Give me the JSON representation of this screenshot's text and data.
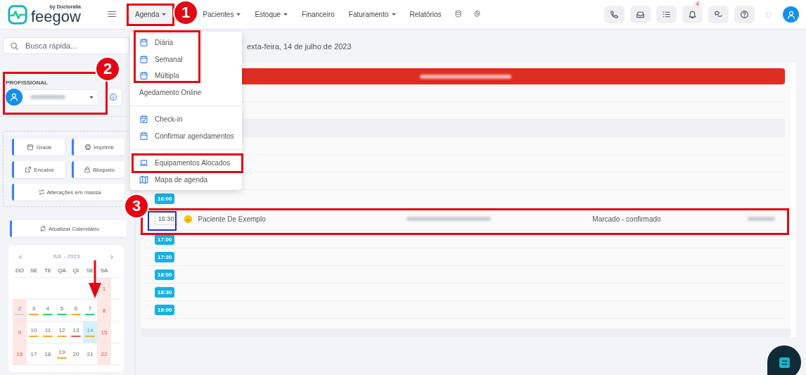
{
  "header": {
    "logo": {
      "name": "feegow",
      "tagline": "by Doctoralia"
    },
    "nav": [
      {
        "label": "Agenda",
        "caret": true,
        "selected": true
      },
      {
        "label": "Pacientes",
        "caret": true,
        "selected": false
      },
      {
        "label": "Estoque",
        "caret": true,
        "selected": false
      },
      {
        "label": "Financeiro",
        "caret": false,
        "selected": false
      },
      {
        "label": "Faturamento",
        "caret": true,
        "selected": false
      },
      {
        "label": "Relatórios",
        "caret": false,
        "selected": false
      }
    ],
    "notification_count": "4"
  },
  "agenda_menu": [
    {
      "kind": "item",
      "label": "Diária"
    },
    {
      "kind": "item",
      "label": "Semanal"
    },
    {
      "kind": "item",
      "label": "Múltipla"
    },
    {
      "kind": "plain",
      "label": "Agedamento Online"
    },
    {
      "kind": "divider"
    },
    {
      "kind": "item",
      "label": "Check-in"
    },
    {
      "kind": "item",
      "label": "Confirmar agendamentos"
    },
    {
      "kind": "divider"
    },
    {
      "kind": "item",
      "label": "Equipamentos Alocados",
      "highlighted": true
    },
    {
      "kind": "item",
      "label": "Mapa de agenda"
    }
  ],
  "sidebar": {
    "search": {
      "placeholder": "Busca rápida..."
    },
    "professional_label": "PROFISSIONAL",
    "actions": [
      {
        "label": "Grade"
      },
      {
        "label": "Imprimir"
      },
      {
        "label": "Encaixe"
      },
      {
        "label": "Bloqueio"
      },
      {
        "label": "Alterações em massa"
      }
    ],
    "refresh": "Atualizar Calendário",
    "calendar": {
      "prev": "‹",
      "month": "JUL - 2023",
      "next": "›",
      "weekdays": [
        "DO",
        "SE",
        "TE",
        "QA",
        "QI",
        "SE",
        "SA"
      ],
      "weeks": [
        [
          {
            "kind": "blank"
          },
          {
            "kind": "blank"
          },
          {
            "kind": "blank"
          },
          {
            "kind": "blank"
          },
          {
            "kind": "blank"
          },
          {
            "kind": "blank"
          },
          {
            "kind": "day",
            "day": "1",
            "selected": false
          }
        ],
        [
          {
            "kind": "day",
            "day": "2",
            "selected": false,
            "color": "#cfd3d8"
          },
          {
            "kind": "day",
            "day": "3",
            "selected": false,
            "color": "#f0ad2e"
          },
          {
            "kind": "day",
            "day": "4",
            "selected": false,
            "color": "#2ecc71"
          },
          {
            "kind": "day",
            "day": "5",
            "selected": false,
            "color": "#2ecc71"
          },
          {
            "kind": "day",
            "day": "6",
            "selected": false,
            "color": "#f0ad2e"
          },
          {
            "kind": "day",
            "day": "7",
            "selected": false,
            "color": "#2ecc71"
          },
          {
            "kind": "day",
            "day": "8",
            "selected": false
          }
        ],
        [
          {
            "kind": "day",
            "day": "9",
            "selected": false
          },
          {
            "kind": "day",
            "day": "10",
            "selected": false,
            "color": "#f0ad2e"
          },
          {
            "kind": "day",
            "day": "11",
            "selected": false,
            "color": "#f0ad2e"
          },
          {
            "kind": "day",
            "day": "12",
            "selected": false,
            "color": "#f0ad2e"
          },
          {
            "kind": "day",
            "day": "13",
            "selected": false,
            "color": "#e05a5a"
          },
          {
            "kind": "day",
            "day": "14",
            "selected": true,
            "color": "#f0ad2e"
          },
          {
            "kind": "day",
            "day": "15",
            "selected": false
          }
        ],
        [
          {
            "kind": "day",
            "day": "16",
            "selected": false
          },
          {
            "kind": "day",
            "day": "17",
            "selected": false
          },
          {
            "kind": "day",
            "day": "18",
            "selected": false
          },
          {
            "kind": "day",
            "day": "19",
            "selected": false,
            "color": "#f0ad2e"
          },
          {
            "kind": "day",
            "day": "20",
            "selected": false
          },
          {
            "kind": "day",
            "day": "21",
            "selected": false
          },
          {
            "kind": "day",
            "day": "22",
            "selected": false
          }
        ]
      ]
    }
  },
  "schedule": {
    "date": "exta-feira, 14 de julho de 2023",
    "rows": [
      {
        "kind": "free",
        "time": "16:00"
      },
      {
        "kind": "appointment",
        "time": "16:30",
        "patient": "Paciente De Exemplo",
        "status": "Marcado - confirmado"
      },
      {
        "kind": "free",
        "time": "17:00"
      },
      {
        "kind": "free",
        "time": "17:30"
      },
      {
        "kind": "free",
        "time": "18:00"
      },
      {
        "kind": "free",
        "time": "18:30"
      },
      {
        "kind": "free",
        "time": "19:00"
      }
    ]
  },
  "annotations": {
    "markers": [
      {
        "label": "1"
      },
      {
        "label": "2"
      },
      {
        "label": "3"
      }
    ]
  }
}
